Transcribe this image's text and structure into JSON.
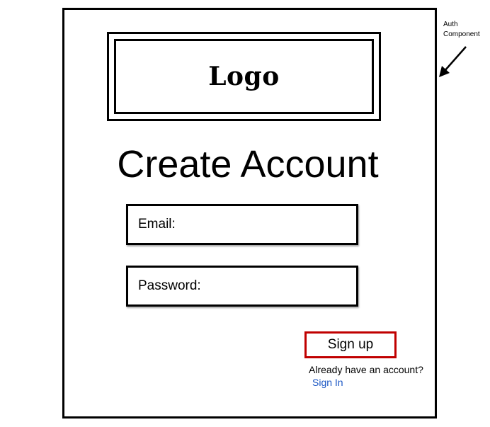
{
  "logo": {
    "text": "Logo"
  },
  "page": {
    "title": "Create Account"
  },
  "form": {
    "email_label": "Email:",
    "password_label": "Password:",
    "signup_label": "Sign up",
    "already_text": "Already have an account?",
    "signin_label": "Sign In"
  },
  "annotation": {
    "line1": "Auth",
    "line2": "Component",
    "icon": "arrow-down-left-icon"
  },
  "colors": {
    "signup_border": "#c00000",
    "link": "#1a56c4"
  }
}
